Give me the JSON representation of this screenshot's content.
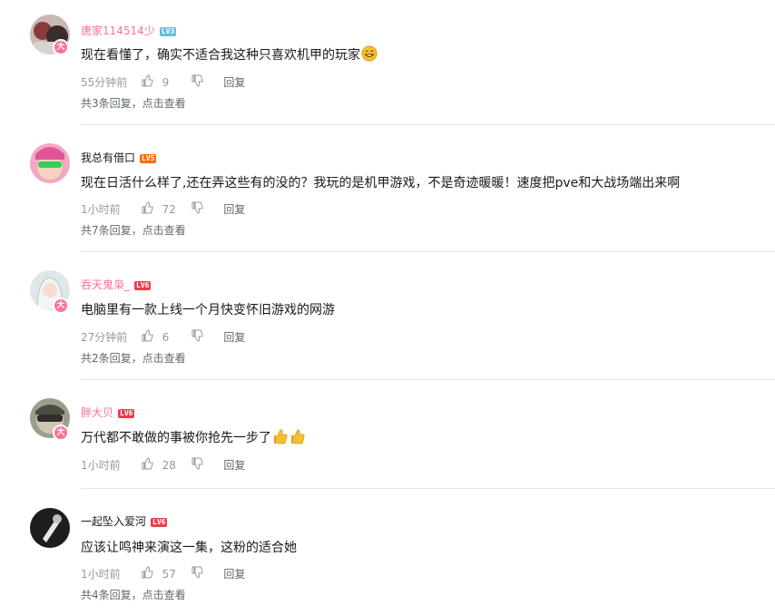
{
  "comments": [
    {
      "username": "唐家114514少",
      "level": "LV3",
      "level_color": "#61c0e0",
      "name_color": "pink",
      "badge": "大",
      "text": "现在看懂了，确实不适合我这种只喜欢机甲的玩家",
      "emoji": [
        "grin-icon"
      ],
      "time": "55分钟前",
      "likes": "9",
      "reply_label": "回复",
      "sub_replies": "共3条回复，点击查看"
    },
    {
      "username": "我总有借口",
      "level": "LV5",
      "level_color": "#ff6c00",
      "name_color": "dark",
      "badge": "",
      "text": "现在日活什么样了,还在弄这些有的没的？我玩的是机甲游戏，不是奇迹暖暖！速度把pve和大战场端出来啊",
      "emoji": [],
      "time": "1小时前",
      "likes": "72",
      "reply_label": "回复",
      "sub_replies": "共7条回复，点击查看"
    },
    {
      "username": "吞天鬼枭_",
      "level": "LV6",
      "level_color": "#ee3c4d",
      "name_color": "pink",
      "badge": "大",
      "text": "电脑里有一款上线一个月快变怀旧游戏的网游",
      "emoji": [],
      "time": "27分钟前",
      "likes": "6",
      "reply_label": "回复",
      "sub_replies": "共2条回复，点击查看"
    },
    {
      "username": "胖大贝",
      "level": "LV6",
      "level_color": "#ee3c4d",
      "name_color": "pink",
      "badge": "大",
      "text": "万代都不敢做的事被你抢先一步了",
      "emoji": [
        "thumbs-up-icon",
        "thumbs-up-icon"
      ],
      "time": "1小时前",
      "likes": "28",
      "reply_label": "回复",
      "sub_replies": ""
    },
    {
      "username": "一起坠入爱河",
      "level": "LV6",
      "level_color": "#ee3c4d",
      "name_color": "dark",
      "badge": "",
      "text": "应该让鸣神来演这一集，这粉的适合她",
      "emoji": [],
      "time": "1小时前",
      "likes": "57",
      "reply_label": "回复",
      "sub_replies": "共4条回复，点击查看"
    }
  ]
}
